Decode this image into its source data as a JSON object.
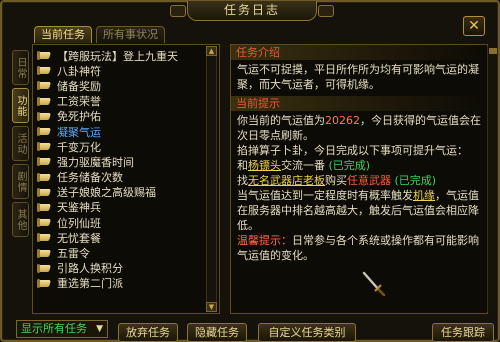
{
  "window": {
    "title": "任务日志",
    "close_glyph": "✕"
  },
  "top_tabs": [
    {
      "label": "当前任务",
      "active": true
    },
    {
      "label": "所有事状况",
      "active": false
    }
  ],
  "side_tabs": [
    {
      "label": "日常",
      "active": false
    },
    {
      "label": "功能",
      "active": true
    },
    {
      "label": "活动",
      "active": false
    },
    {
      "label": "剧情",
      "active": false
    },
    {
      "label": "其他",
      "active": false
    }
  ],
  "quests": [
    "【跨服玩法】登上九重天",
    "八卦神符",
    "储备奖励",
    "工资荣誉",
    "免死护佑",
    "凝聚气运",
    "千变万化",
    "强力驱魔香时间",
    "任务储备次数",
    "送子娘娘之高级赐福",
    "天鉴神兵",
    "位列仙班",
    "无忧套餐",
    "五雷令",
    "引路人换积分",
    "重选第二门派"
  ],
  "selected_quest_index": 5,
  "detail": {
    "intro_heading": "任务介绍",
    "intro_text": "气运不可捉摸，平日所作所为均有可影响气运的凝聚，而大气运者，可得机缘。",
    "hint_heading": "当前提示",
    "line1_a": "你当前的气运值为",
    "fortune_value": "20262",
    "line1_b": "，今日获得的气运值会在次日零点刷新。",
    "line2": "掐掸算子卜卦，今日完成以下事项可提升气运：",
    "line3_a": "和",
    "npc1": "杨镖头",
    "line3_b": "交流一番",
    "done1": "(已完成)",
    "line4_a": "找",
    "npc2": "无名武器店老板",
    "line4_b": "购买",
    "item": "任意武器",
    "done2": "(已完成)",
    "line5_a": "当气运值达到一定程度时有概率触发",
    "chance": "机缘",
    "line5_b": "，气运值在服务器中排名越高越大，触发后气运值会相应降低。",
    "tip_label": "温馨提示：",
    "tip_text": "日常参与各个系统或操作都有可能影响气运值的变化。"
  },
  "bottom": {
    "filter_label": "显示所有任务",
    "filter_arrow": "▼",
    "abandon": "放弃任务",
    "hide": "隐藏任务",
    "custom": "自定义任务类别",
    "track": "任务跟踪"
  },
  "colors": {
    "frame": "#6d5a26",
    "heading": "#e85a38",
    "selected_quest": "#5aa8ff",
    "completed": "#3fd15a",
    "value_orange": "#ff7a3a"
  }
}
